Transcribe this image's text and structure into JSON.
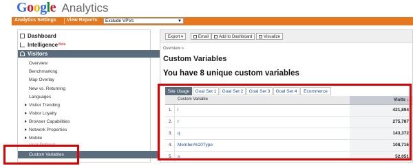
{
  "brand": {
    "google_letters": [
      {
        "ch": "G",
        "color": "#3369e8"
      },
      {
        "ch": "o",
        "color": "#d50f25"
      },
      {
        "ch": "o",
        "color": "#eeb211"
      },
      {
        "ch": "g",
        "color": "#3369e8"
      },
      {
        "ch": "l",
        "color": "#009925"
      },
      {
        "ch": "e",
        "color": "#d50f25"
      }
    ],
    "product": "Analytics"
  },
  "nav": {
    "settings": "Analytics Settings",
    "view_reports": "View Reports:",
    "selected_report": "Exclude VPVs"
  },
  "sidebar": {
    "dashboard": "Dashboard",
    "intelligence": "Intelligence",
    "beta": "Beta",
    "visitors": "Visitors",
    "items": [
      "Overview",
      "Benchmarking",
      "Map Overlay",
      "New vs. Returning",
      "Languages",
      "Visitor Trending",
      "Visitor Loyalty",
      "Browser Capabilities",
      "Network Properties",
      "Mobile",
      "User Defined",
      "Custom Variables"
    ]
  },
  "toolbar": {
    "export": "Export ▾",
    "email": "Email",
    "add_dashboard": "Add to Dashboard",
    "visualize": "Visualize"
  },
  "breadcrumb": "Overview »",
  "page_title": "Custom Variables",
  "headline": "You have 8 unique custom variables",
  "tabs": [
    "Site Usage",
    "Goal Set 1",
    "Goal Set 2",
    "Goal Set 3",
    "Goal Set 4",
    "Ecommerce"
  ],
  "table": {
    "col_variable": "Custom Variable",
    "col_visits": "Visits ↓",
    "rows": [
      {
        "n": "1.",
        "var": "l",
        "visits": "421,894"
      },
      {
        "n": "2.",
        "var": "r",
        "visits": "275,787"
      },
      {
        "n": "3.",
        "var": "q",
        "visits": "143,372"
      },
      {
        "n": "4.",
        "var": "Member%20Type",
        "visits": "108,716"
      },
      {
        "n": "5.",
        "var": "s",
        "visits": "52,051"
      }
    ]
  },
  "colors": {
    "accent_orange": "#e8761d",
    "highlight_red": "#e00000",
    "selected_gray": "#5b6c7c",
    "link_blue": "#1a4da1"
  }
}
